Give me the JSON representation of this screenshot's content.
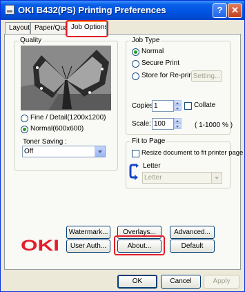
{
  "window": {
    "title": "OKI B432(PS) Printing Preferences",
    "help_glyph": "?",
    "close_glyph": "✕"
  },
  "tabs": [
    {
      "label": "Layout"
    },
    {
      "label": "Paper/Quality"
    },
    {
      "label": "Job Options",
      "active": true
    }
  ],
  "quality": {
    "group_label": "Quality",
    "options": [
      {
        "label": "Fine / Detail(1200x1200)",
        "selected": false
      },
      {
        "label": "Normal(600x600)",
        "selected": true
      }
    ],
    "toner_saving_label": "Toner Saving :",
    "toner_saving_value": "Off"
  },
  "job_type": {
    "group_label": "Job Type",
    "options": [
      {
        "label": "Normal",
        "selected": true
      },
      {
        "label": "Secure Print",
        "selected": false
      },
      {
        "label": "Store for Re-print",
        "selected": false
      }
    ],
    "setting_button": "Setting...",
    "copies_label": "Copies",
    "copies_value": "1",
    "collate_label": "Collate",
    "scale_label": "Scale:",
    "scale_value": "100",
    "scale_range": "( 1-1000 % )"
  },
  "fit_to_page": {
    "group_label": "Fit to Page",
    "resize_label": "Resize document to fit printer page",
    "paper_name": "Letter",
    "paper_select_value": "Letter"
  },
  "buttons": {
    "watermark": "Watermark...",
    "overlays": "Overlays...",
    "advanced": "Advanced...",
    "user_auth": "User Auth...",
    "about": "About...",
    "default": "Default"
  },
  "logo_text": "OKI",
  "footer": {
    "ok": "OK",
    "cancel": "Cancel",
    "apply": "Apply"
  },
  "colors": {
    "title_bar": "#0054e3",
    "highlight": "#e31d2a",
    "logo_red": "#e31d2a",
    "radio_dot": "#21a121"
  }
}
